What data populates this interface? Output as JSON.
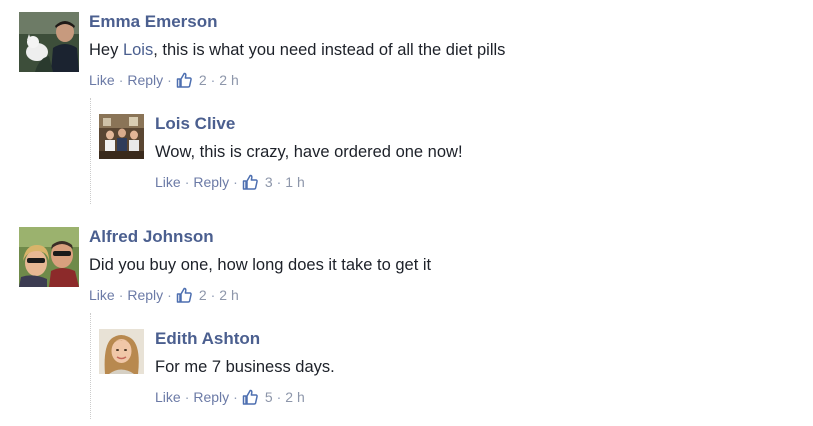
{
  "comments": [
    {
      "author": "Emma Emerson",
      "text_before": "Hey ",
      "mention": "Lois",
      "text_after": ", this is what you need instead of all the diet pills",
      "like": "Like",
      "reply": "Reply",
      "likes": "2",
      "time": "2 h",
      "reply_comment": {
        "author": "Lois Clive",
        "text": "Wow, this is crazy, have ordered one now!",
        "like": "Like",
        "reply": "Reply",
        "likes": "3",
        "time": "1 h"
      }
    },
    {
      "author": "Alfred Johnson",
      "text": "Did you buy one, how long does it take to get it",
      "like": "Like",
      "reply": "Reply",
      "likes": "2",
      "time": "2 h",
      "reply_comment": {
        "author": "Edith Ashton",
        "text": "For me 7 business days.",
        "like": "Like",
        "reply": "Reply",
        "likes": "5",
        "time": "2 h"
      }
    }
  ],
  "separator": "·",
  "icons": {
    "like": "thumbs-up-icon"
  },
  "colors": {
    "author": "#4b5f8f",
    "link": "#6b7aa6",
    "meta": "#8d96aa"
  }
}
